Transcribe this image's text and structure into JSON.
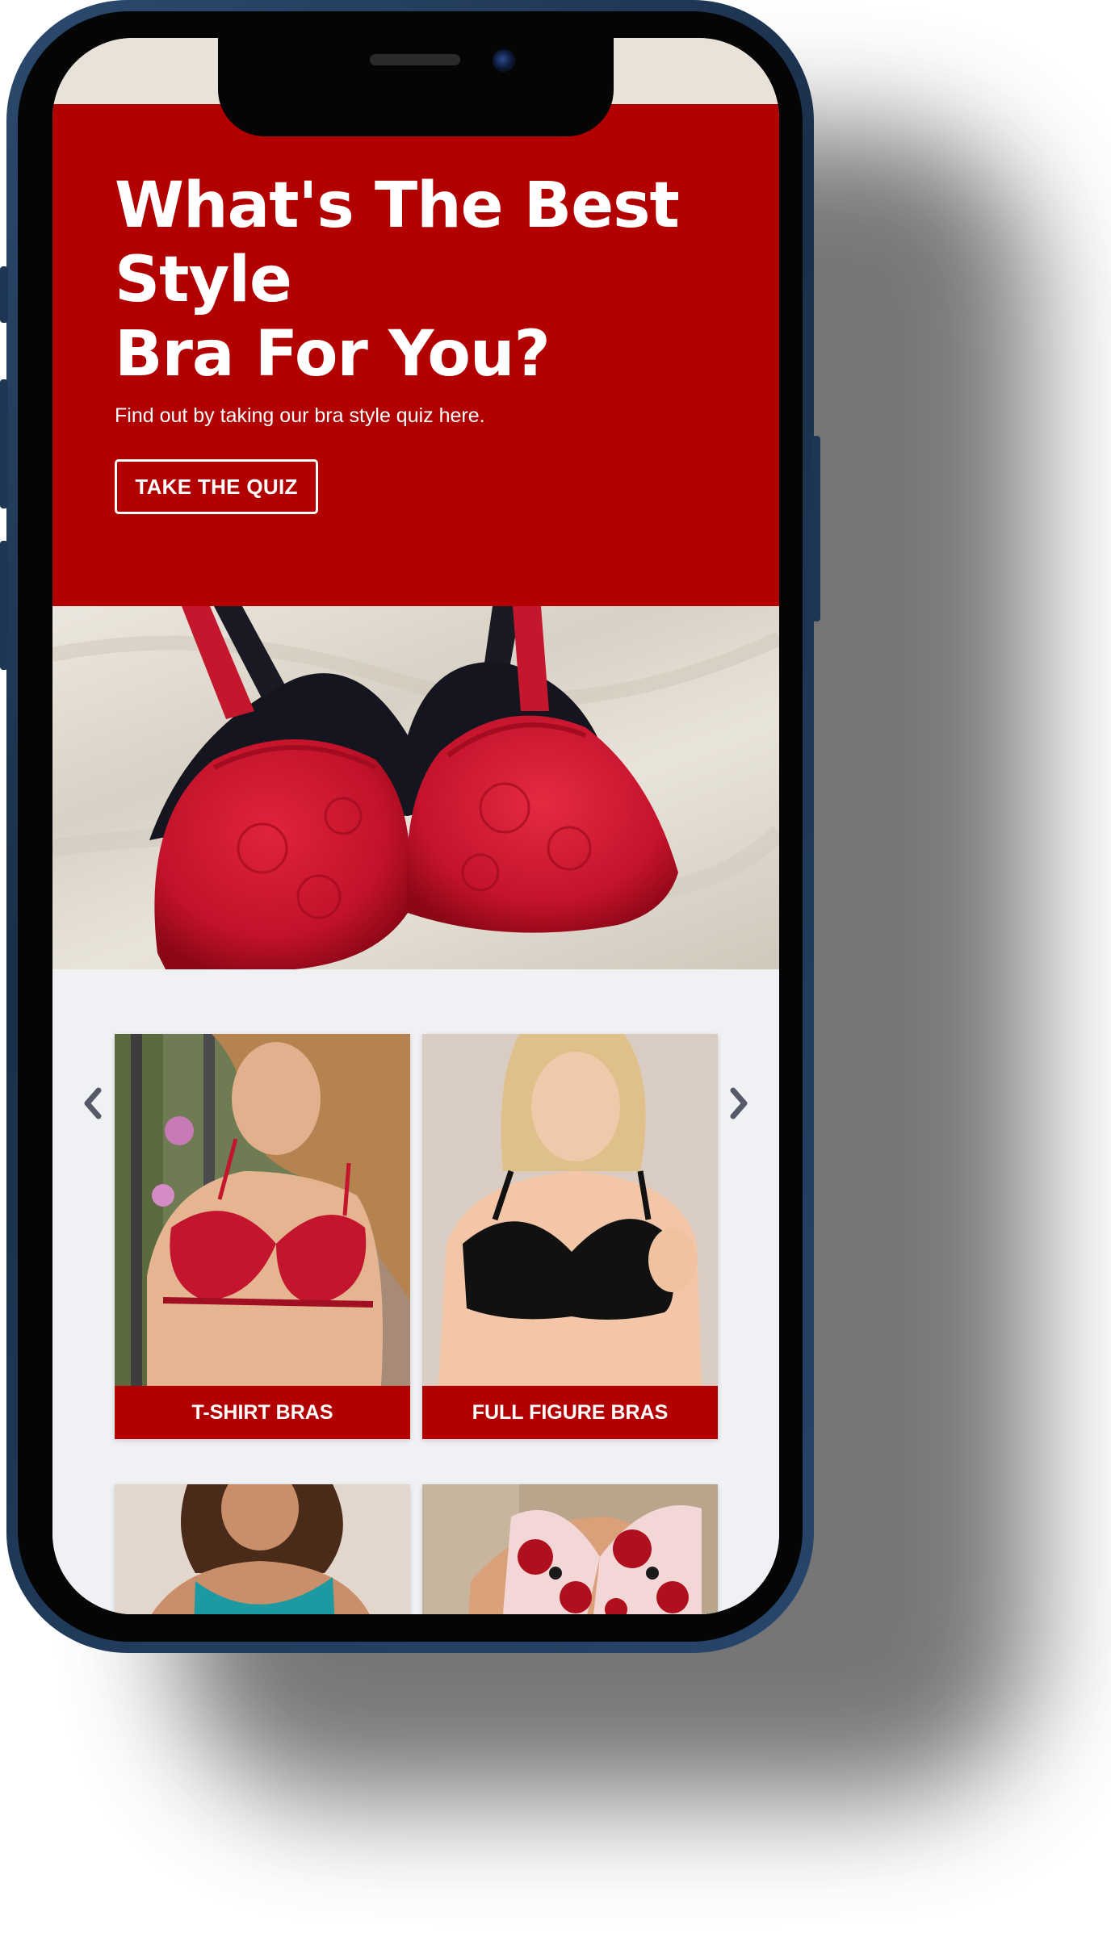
{
  "hero": {
    "title": "What's The Best\nStyle\nBra For You?",
    "subtitle": "Find out by taking our bra style quiz here.",
    "cta_label": "TAKE THE QUIZ"
  },
  "products": [
    {
      "label": "T-SHIRT BRAS",
      "icon": "model-red-tshirt-bra-photo"
    },
    {
      "label": "FULL FIGURE BRAS",
      "icon": "model-black-full-figure-bra-photo"
    },
    {
      "label": "",
      "icon": "model-teal-camisole-photo"
    },
    {
      "label": "",
      "icon": "model-floral-bra-photo"
    }
  ],
  "colors": {
    "brand_red": "#b20000",
    "background": "#eff1f5",
    "phone_frame": "#1f3a5c"
  },
  "carousel": {
    "prev_icon": "chevron-left-icon",
    "next_icon": "chevron-right-icon"
  }
}
